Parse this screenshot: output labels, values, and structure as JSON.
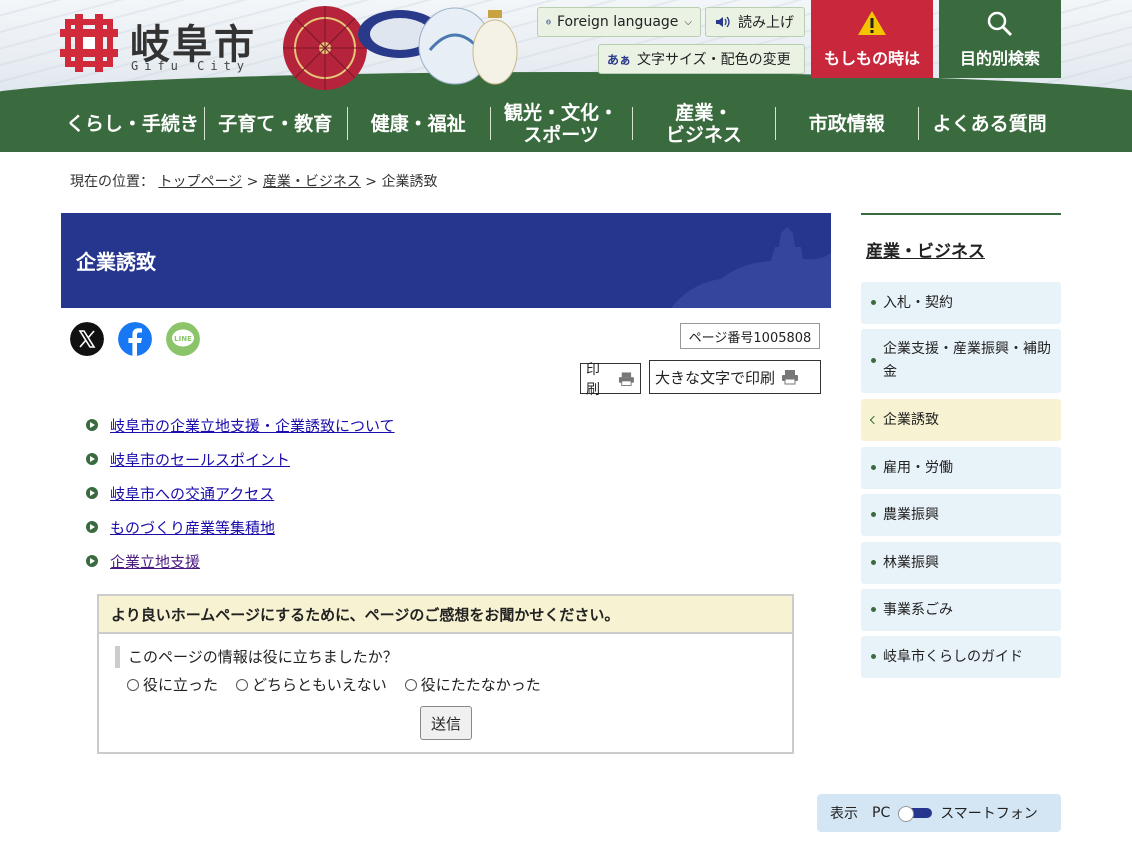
{
  "header": {
    "logo_text": "岐阜市",
    "logo_sub": "Gifu City",
    "foreign_language": "Foreign language",
    "read_aloud": "読み上げ",
    "font_color_icon": "あぁ",
    "font_color": "文字サイズ・配色の変更",
    "emergency": "もしもの時は",
    "purpose_search": "目的別検索",
    "colors": {
      "emergency": "#c9283c",
      "brand_green": "#3a6b3e",
      "title_blue": "#26368f"
    }
  },
  "nav": {
    "items": [
      {
        "label": "くらし・手続き"
      },
      {
        "label": "子育て・教育"
      },
      {
        "label": "健康・福祉"
      },
      {
        "label": "観光・文化・\nスポーツ"
      },
      {
        "label": "産業・\nビジネス"
      },
      {
        "label": "市政情報"
      },
      {
        "label": "よくある質問"
      }
    ]
  },
  "breadcrumb": {
    "prefix": "現在の位置：",
    "items": [
      "トップページ",
      "産業・ビジネス",
      "企業誘致"
    ],
    "separator": ">"
  },
  "main": {
    "title": "企業誘致",
    "page_number": "ページ番号1005808",
    "print": "印刷",
    "print_large": "大きな文字で印刷",
    "links": [
      "岐阜市の企業立地支援・企業誘致について",
      "岐阜市のセールスポイント",
      "岐阜市への交通アクセス",
      "ものづくり産業等集積地",
      "企業立地支援"
    ]
  },
  "survey": {
    "heading": "より良いホームページにするために、ページのご感想をお聞かせください。",
    "question": "このページの情報は役に立ちましたか？",
    "options": [
      "役に立った",
      "どちらともいえない",
      "役にたたなかった"
    ],
    "submit": "送信"
  },
  "sidebar": {
    "title": "産業・ビジネス",
    "items": [
      {
        "label": "入札・契約"
      },
      {
        "label": "企業支援・産業振興・補助金"
      },
      {
        "label": "企業誘致",
        "current": true
      },
      {
        "label": "雇用・労働"
      },
      {
        "label": "農業振興"
      },
      {
        "label": "林業振興"
      },
      {
        "label": "事業系ごみ"
      },
      {
        "label": "岐阜市くらしのガイド"
      }
    ]
  },
  "display_switch": {
    "label": "表示",
    "pc": "PC",
    "smartphone": "スマートフォン"
  }
}
